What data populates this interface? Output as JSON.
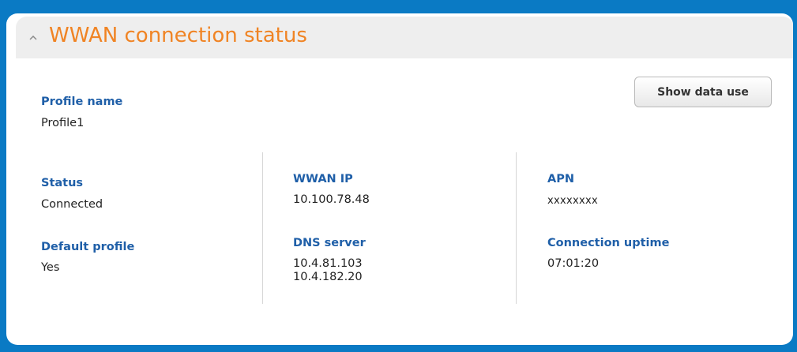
{
  "panel": {
    "title": "WWAN connection status",
    "show_data_use_label": "Show data use"
  },
  "fields": {
    "profile_name": {
      "label": "Profile name",
      "value": "Profile1"
    },
    "status": {
      "label": "Status",
      "value": "Connected"
    },
    "default_profile": {
      "label": "Default profile",
      "value": "Yes"
    },
    "wwan_ip": {
      "label": "WWAN IP",
      "value": "10.100.78.48"
    },
    "dns_server": {
      "label": "DNS server",
      "values": [
        "10.4.81.103",
        "10.4.182.20"
      ]
    },
    "apn": {
      "label": "APN",
      "value": "xxxxxxxx"
    },
    "connection_uptime": {
      "label": "Connection uptime",
      "value": "07:01:20"
    }
  },
  "colors": {
    "title": "#f08424",
    "label": "#1f5fa8",
    "frame": "#0a7ac4"
  },
  "icons": {
    "collapse": "chevron-up-icon"
  }
}
